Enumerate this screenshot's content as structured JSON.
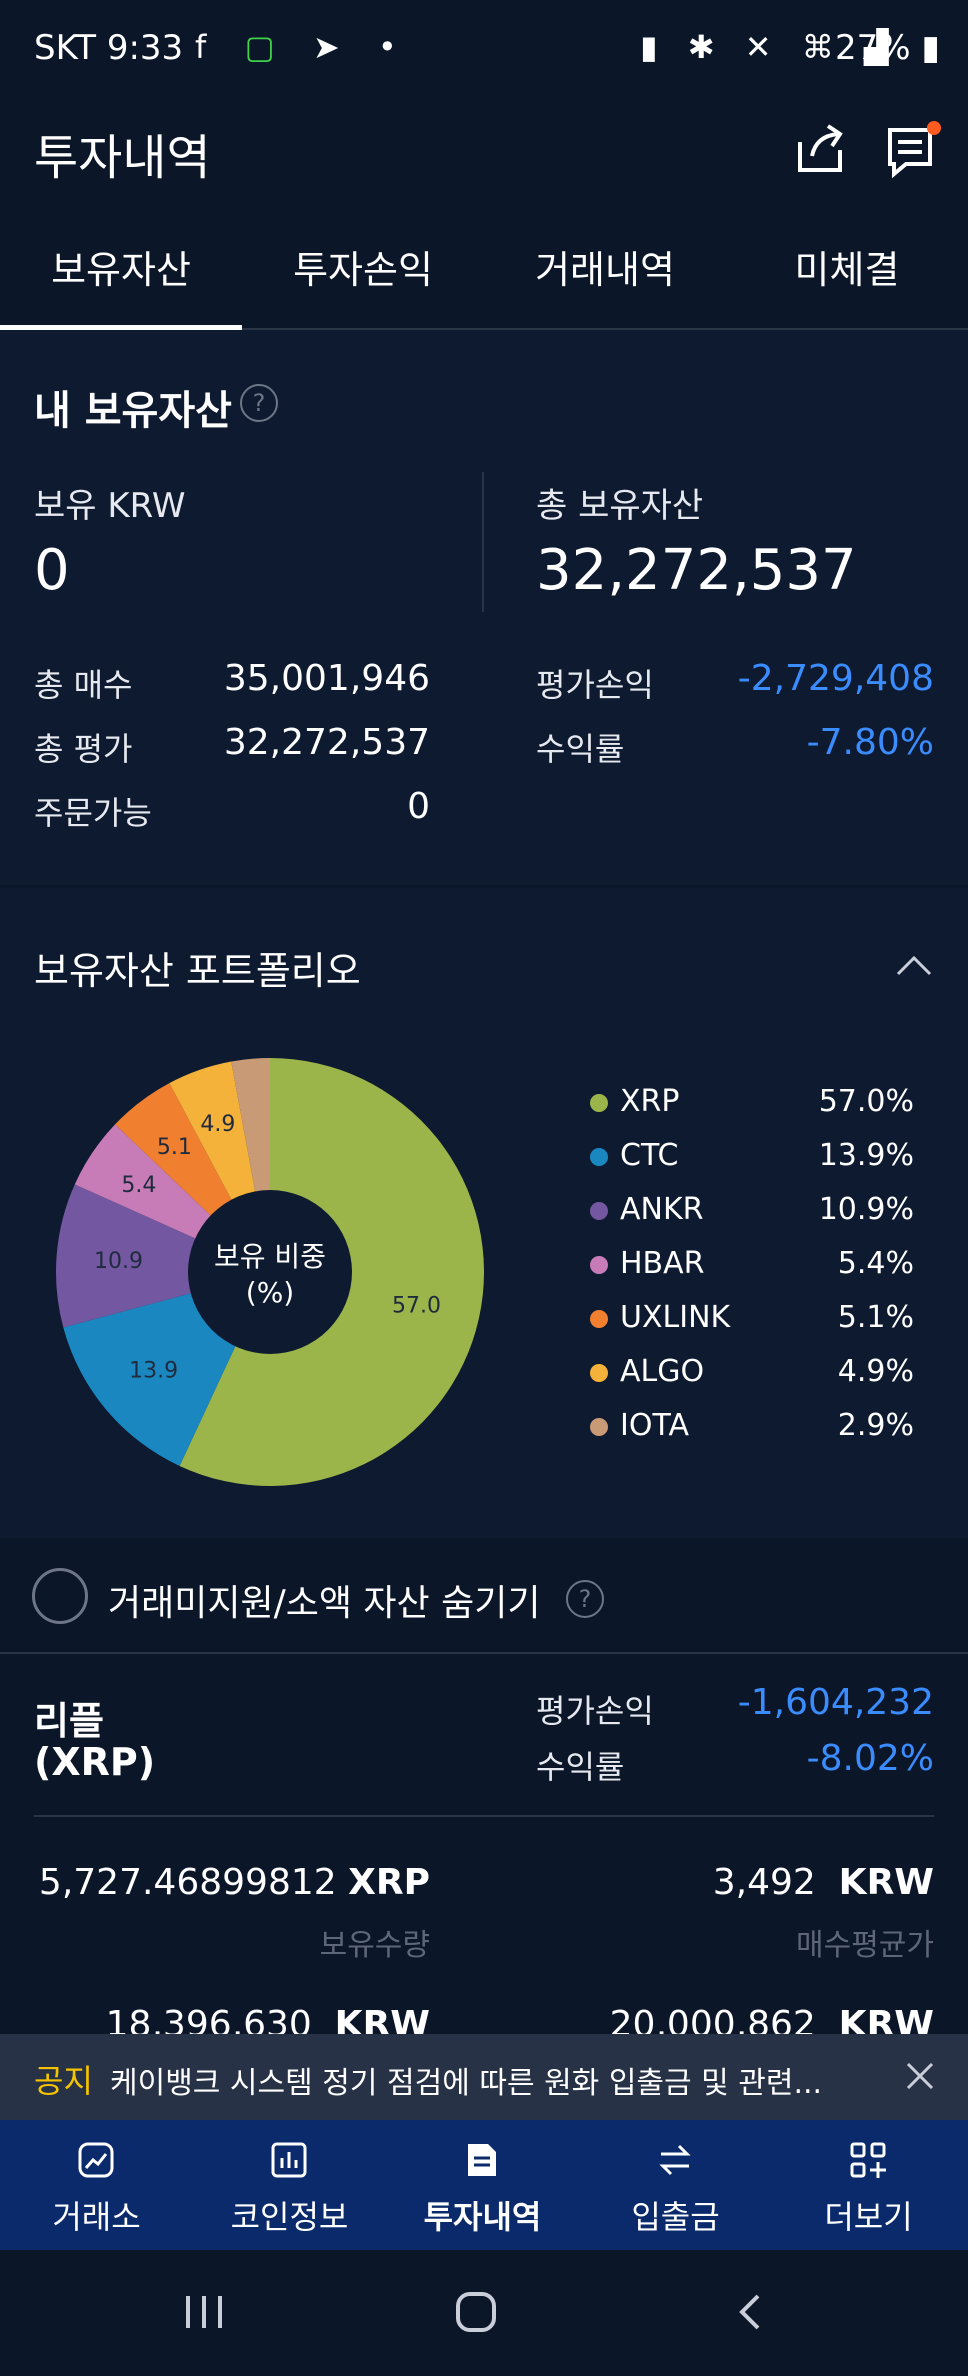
{
  "status_bar": {
    "time": "SKT 9:33",
    "battery": "27%",
    "icons": [
      "facebook-icon",
      "app-icon",
      "telegram-icon",
      "dot-icon",
      "battery-saver-icon",
      "bluetooth-icon",
      "mute-icon",
      "5g-icon",
      "signal-icon",
      "battery-icon"
    ]
  },
  "header": {
    "title": "투자내역",
    "icons": [
      "share-icon",
      "notice-icon"
    ]
  },
  "tabs": [
    {
      "label": "보유자산",
      "active": true
    },
    {
      "label": "투자손익",
      "active": false
    },
    {
      "label": "거래내역",
      "active": false
    },
    {
      "label": "미체결",
      "active": false
    }
  ],
  "summary": {
    "title": "내 보유자산",
    "help": "?",
    "krw_label": "보유 KRW",
    "krw_value": "0",
    "total_label": "총 보유자산",
    "total_value": "32,272,537",
    "rows_left": [
      {
        "label": "총 매수",
        "value": "35,001,946"
      },
      {
        "label": "총 평가",
        "value": "32,272,537"
      },
      {
        "label": "주문가능",
        "value": "0"
      }
    ],
    "rows_right": [
      {
        "label": "평가손익",
        "value": "-2,729,408"
      },
      {
        "label": "수익률",
        "value": "-7.80%"
      }
    ]
  },
  "portfolio": {
    "title": "보유자산 포트폴리오",
    "center_label_1": "보유 비중",
    "center_label_2": "(%)",
    "colors": {
      "XRP": "#9bb54b",
      "CTC": "#1b87c1",
      "ANKR": "#7358a1",
      "HBAR": "#c77cb8",
      "UXLINK": "#f08030",
      "ALGO": "#f5b23a",
      "IOTA": "#c99a76"
    }
  },
  "chart_data": {
    "type": "pie",
    "title": "보유자산 포트폴리오",
    "categories": [
      "XRP",
      "CTC",
      "ANKR",
      "HBAR",
      "UXLINK",
      "ALGO",
      "IOTA"
    ],
    "values": [
      57.0,
      13.9,
      10.9,
      5.4,
      5.1,
      4.9,
      2.9
    ],
    "value_labels": [
      "57.0",
      "13.9",
      "10.9",
      "5.4",
      "5.1",
      "4.9",
      ""
    ],
    "legend": [
      "57.0%",
      "13.9%",
      "10.9%",
      "5.4%",
      "5.1%",
      "4.9%",
      "2.9%"
    ]
  },
  "filter": {
    "label": "거래미지원/소액 자산 숨기기",
    "help": "?"
  },
  "asset": {
    "name_line1": "리플",
    "name_line2": "(XRP)",
    "pl_label": "평가손익",
    "pl_value": "-1,604,232",
    "rate_label": "수익률",
    "rate_value": "-8.02%",
    "qty_value": "5,727.46899812",
    "qty_unit": "XRP",
    "qty_label": "보유수량",
    "avg_value": "3,492",
    "avg_unit": "KRW",
    "avg_label": "매수평균가",
    "next_left_value": "18,396,630",
    "next_left_unit": "KRW",
    "next_right_value": "20,000,862",
    "next_right_unit": "KRW"
  },
  "notice": {
    "tag": "공지",
    "text": "케이뱅크 시스템 정기 점검에 따른 원화 입출금 및 관련..."
  },
  "bottom_nav": [
    {
      "label": "거래소",
      "icon": "chart-up-icon",
      "active": false
    },
    {
      "label": "코인정보",
      "icon": "bar-chart-icon",
      "active": false
    },
    {
      "label": "투자내역",
      "icon": "document-icon",
      "active": true
    },
    {
      "label": "입출금",
      "icon": "transfer-icon",
      "active": false
    },
    {
      "label": "더보기",
      "icon": "grid-plus-icon",
      "active": false
    }
  ],
  "system_nav": [
    "recent-apps-icon",
    "home-icon",
    "back-icon"
  ]
}
